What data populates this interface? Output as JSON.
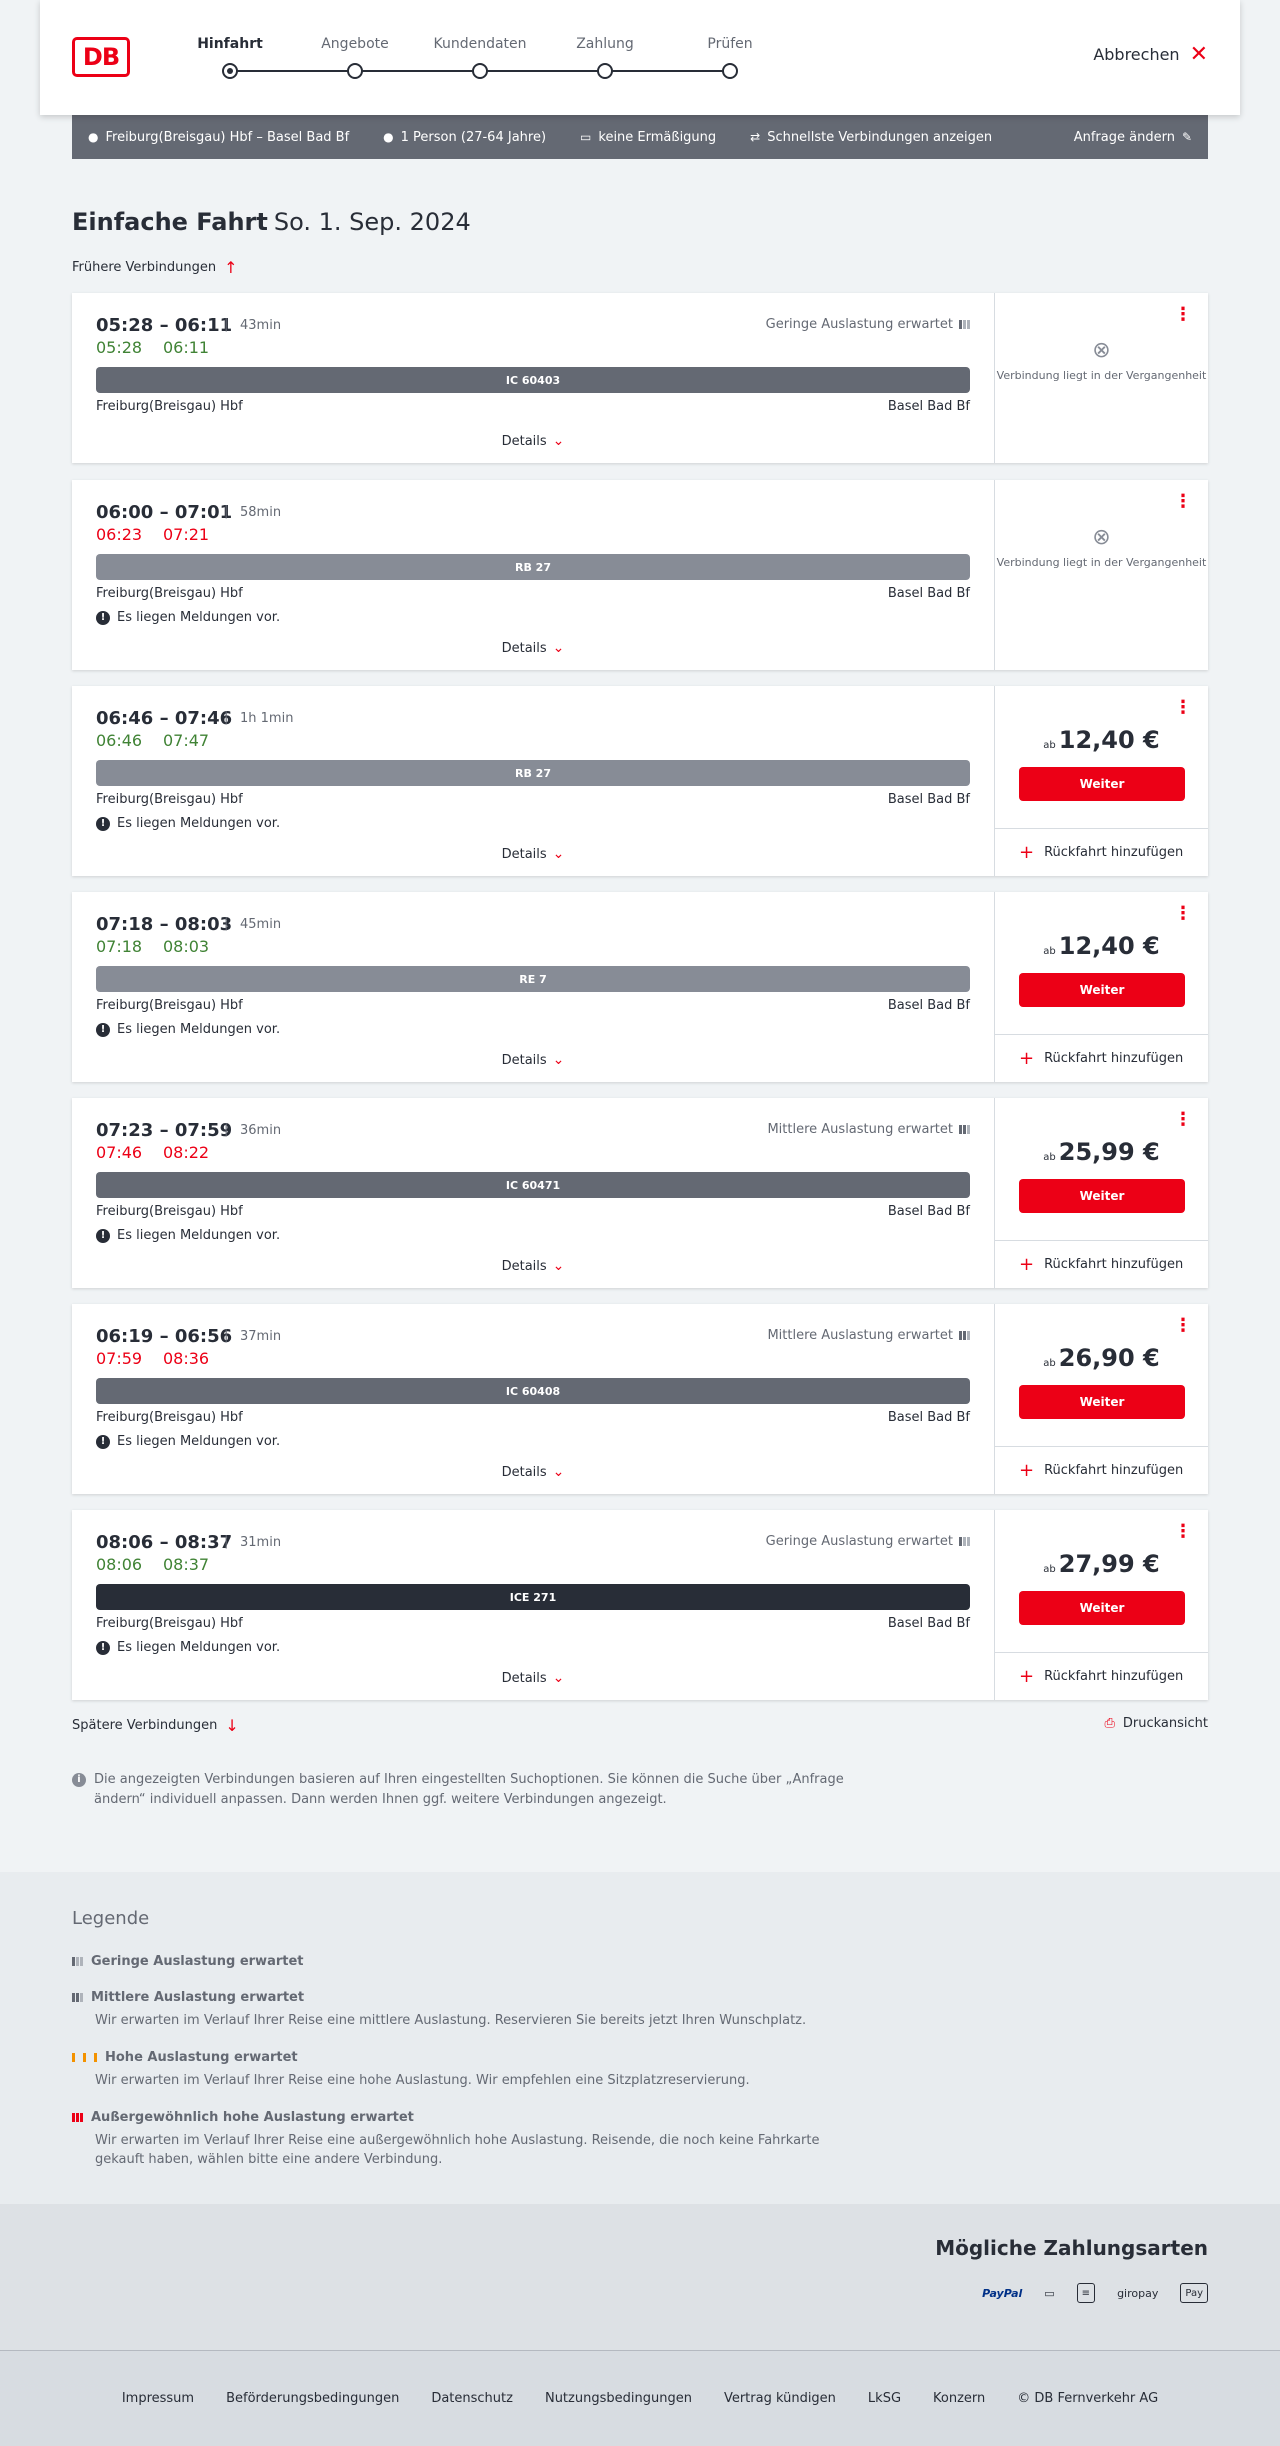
{
  "header": {
    "logo": "DB",
    "steps": [
      {
        "label": "Hinfahrt"
      },
      {
        "label": "Angebote"
      },
      {
        "label": "Kundendaten"
      },
      {
        "label": "Zahlung"
      },
      {
        "label": "Prüfen"
      }
    ],
    "cancel": "Abbrechen"
  },
  "search_bar": {
    "route": "Freiburg(Breisgau) Hbf – Basel Bad Bf",
    "travellers": "1 Person (27-64 Jahre)",
    "discount": "keine Ermäßigung",
    "fastest": "Schnellste Verbindungen anzeigen",
    "change": "Anfrage ändern"
  },
  "page": {
    "title": "Einfache Fahrt",
    "date": "So. 1. Sep. 2024",
    "earlier": "Frühere Verbindungen",
    "later": "Spätere Verbindungen",
    "print": "Druckansicht",
    "info": "Die angezeigten Verbindungen basieren auf Ihren eingestellten Suchoptionen. Sie können die Suche über „Anfrage ändern“ individuell anpassen. Dann werden Ihnen ggf. weitere Verbindungen angezeigt."
  },
  "common": {
    "from": "Freiburg(Breisgau) Hbf",
    "to": "Basel Bad Bf",
    "details": "Details",
    "messages": "Es liegen Meldungen vor.",
    "past": "Verbindung liegt in der Vergangenheit",
    "ab": "ab",
    "weiter": "Weiter",
    "return": "Rückfahrt hinzufügen"
  },
  "connections": [
    {
      "times": "05:28 – 06:11",
      "duration": "43min",
      "real_dep": "05:28",
      "real_arr": "06:11",
      "dep_color": "green",
      "arr_color": "green",
      "train": "IC 60403",
      "train_color": "#646973",
      "occupancy": "Geringe Auslastung erwartet",
      "occ_level": "low",
      "messages": false,
      "past": true,
      "price": ""
    },
    {
      "times": "06:00 – 07:01",
      "duration": "58min",
      "real_dep": "06:23",
      "real_arr": "07:21",
      "dep_color": "red",
      "arr_color": "red",
      "train": "RB 27",
      "train_color": "#878c96",
      "occupancy": "",
      "occ_level": "",
      "messages": true,
      "past": true,
      "price": ""
    },
    {
      "times": "06:46 – 07:46",
      "duration": "1h 1min",
      "real_dep": "06:46",
      "real_arr": "07:47",
      "dep_color": "green",
      "arr_color": "green",
      "train": "RB 27",
      "train_color": "#878c96",
      "occupancy": "",
      "occ_level": "",
      "messages": true,
      "past": false,
      "price": "12,40 €"
    },
    {
      "times": "07:18 – 08:03",
      "duration": "45min",
      "real_dep": "07:18",
      "real_arr": "08:03",
      "dep_color": "green",
      "arr_color": "green",
      "train": "RE 7",
      "train_color": "#878c96",
      "occupancy": "",
      "occ_level": "",
      "messages": true,
      "past": false,
      "price": "12,40 €"
    },
    {
      "times": "07:23 – 07:59",
      "duration": "36min",
      "real_dep": "07:46",
      "real_arr": "08:22",
      "dep_color": "red",
      "arr_color": "red",
      "train": "IC 60471",
      "train_color": "#646973",
      "occupancy": "Mittlere Auslastung erwartet",
      "occ_level": "medium",
      "messages": true,
      "past": false,
      "price": "25,99 €"
    },
    {
      "times": "06:19 – 06:56",
      "duration": "37min",
      "real_dep": "07:59",
      "real_arr": "08:36",
      "dep_color": "red",
      "arr_color": "red",
      "train": "IC 60408",
      "train_color": "#646973",
      "occupancy": "Mittlere Auslastung erwartet",
      "occ_level": "medium",
      "messages": true,
      "past": false,
      "price": "26,90 €"
    },
    {
      "times": "08:06 – 08:37",
      "duration": "31min",
      "real_dep": "08:06",
      "real_arr": "08:37",
      "dep_color": "green",
      "arr_color": "green",
      "train": "ICE 271",
      "train_color": "#282d37",
      "occupancy": "Geringe Auslastung erwartet",
      "occ_level": "low",
      "messages": true,
      "past": false,
      "price": "27,99 €"
    }
  ],
  "legend": {
    "title": "Legende",
    "items": [
      {
        "title": "Geringe Auslastung erwartet",
        "text": "",
        "level": "low"
      },
      {
        "title": "Mittlere Auslastung erwartet",
        "text": "Wir erwarten im Verlauf Ihrer Reise eine mittlere Auslastung. Reservieren Sie bereits jetzt Ihren Wunschplatz.",
        "level": "medium"
      },
      {
        "title": "Hohe Auslastung erwartet",
        "text": "Wir erwarten im Verlauf Ihrer Reise eine hohe Auslastung. Wir empfehlen eine Sitzplatzreservierung.",
        "level": "high"
      },
      {
        "title": "Außergewöhnlich hohe Auslastung erwartet",
        "text": "Wir erwarten im Verlauf Ihrer Reise eine außergewöhnlich hohe Auslastung. Reisende, die noch keine Fahrkarte gekauft haben, wählen bitte eine andere Verbindung.",
        "level": "extreme"
      }
    ]
  },
  "payment": {
    "title": "Mögliche Zahlungsarten",
    "methods": [
      {
        "name": "PayPal",
        "icon": "paypal-icon"
      },
      {
        "name": "",
        "icon": "card-payment-icon"
      },
      {
        "name": "",
        "icon": "sepa-icon"
      },
      {
        "name": "giropay",
        "icon": "giropay-icon"
      },
      {
        "name": "Pay",
        "icon": "apple-pay-icon"
      }
    ]
  },
  "footer": {
    "links": [
      "Impressum",
      "Beförderungsbedingungen",
      "Datenschutz",
      "Nutzungsbedingungen",
      "Vertrag kündigen",
      "LkSG",
      "Konzern",
      "© DB Fernverkehr AG"
    ]
  }
}
